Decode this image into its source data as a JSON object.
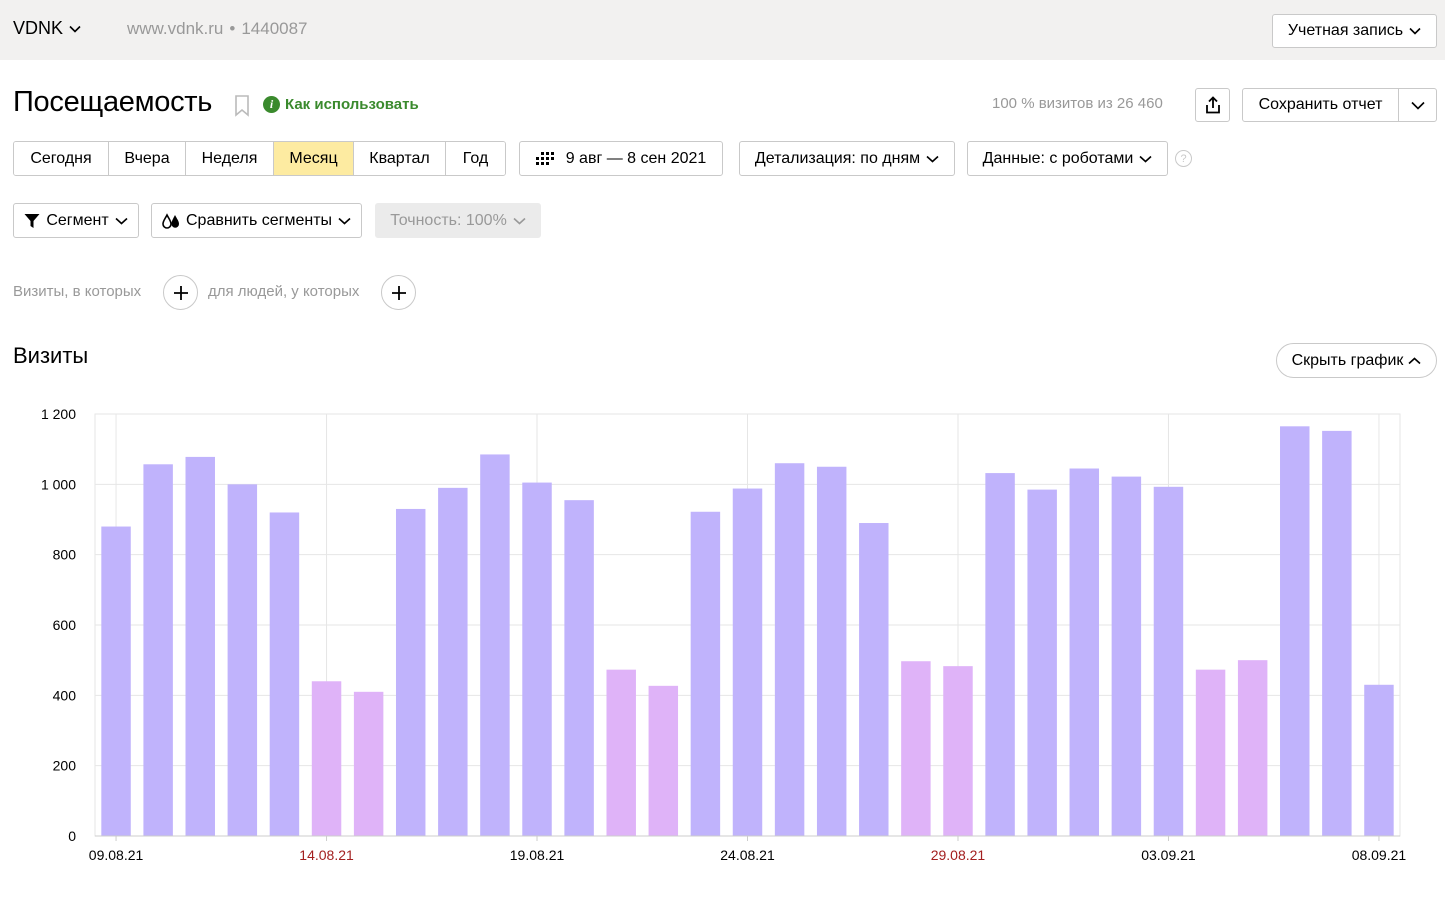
{
  "topbar": {
    "site_name": "VDNK",
    "site_url": "www.vdnk.ru",
    "separator": "•",
    "counter_id": "1440087",
    "account_label": "Учетная запись"
  },
  "header": {
    "title": "Посещаемость",
    "howto_label": "Как использовать",
    "visits_total": "100 % визитов из 26 460",
    "save_label": "Сохранить отчет"
  },
  "periods": [
    {
      "label": "Сегодня",
      "active": false
    },
    {
      "label": "Вчера",
      "active": false
    },
    {
      "label": "Неделя",
      "active": false
    },
    {
      "label": "Месяц",
      "active": true
    },
    {
      "label": "Квартал",
      "active": false
    },
    {
      "label": "Год",
      "active": false
    }
  ],
  "controls": {
    "date_range": "9 авг — 8 сен 2021",
    "detail": "Детализация: по дням",
    "data_mode": "Данные: с роботами",
    "help": "?",
    "segment": "Сегмент",
    "compare": "Сравнить сегменты",
    "accuracy": "Точность: 100%"
  },
  "filters": {
    "visits_label": "Визиты, в которых",
    "people_label": "для людей, у которых"
  },
  "chart_section": {
    "title": "Визиты",
    "hide_label": "Скрыть график"
  },
  "colors": {
    "weekday": "#c0b3fc",
    "weekend": "#dfb3f8",
    "weekend_label": "#a31f1f",
    "accent_yellow": "#fdeba1",
    "link_green": "#3a8a2d"
  },
  "chart_data": {
    "type": "bar",
    "title": "",
    "xlabel": "",
    "ylabel": "",
    "ylim": [
      0,
      1200
    ],
    "yticks": [
      "0",
      "200",
      "400",
      "600",
      "800",
      "1 000",
      "1 200"
    ],
    "ytick_values": [
      0,
      200,
      400,
      600,
      800,
      1000,
      1200
    ],
    "categories": [
      "09.08.21",
      "10.08.21",
      "11.08.21",
      "12.08.21",
      "13.08.21",
      "14.08.21",
      "15.08.21",
      "16.08.21",
      "17.08.21",
      "18.08.21",
      "19.08.21",
      "20.08.21",
      "21.08.21",
      "22.08.21",
      "23.08.21",
      "24.08.21",
      "25.08.21",
      "26.08.21",
      "27.08.21",
      "28.08.21",
      "29.08.21",
      "30.08.21",
      "31.08.21",
      "01.09.21",
      "02.09.21",
      "03.09.21",
      "04.09.21",
      "05.09.21",
      "06.09.21",
      "07.09.21",
      "08.09.21"
    ],
    "values": [
      880,
      1057,
      1078,
      1000,
      920,
      440,
      410,
      930,
      990,
      1085,
      1005,
      955,
      473,
      427,
      922,
      988,
      1060,
      1050,
      890,
      497,
      483,
      1032,
      985,
      1045,
      1022,
      993,
      473,
      500,
      1165,
      1152,
      430
    ],
    "weekend": [
      false,
      false,
      false,
      false,
      false,
      true,
      true,
      false,
      false,
      false,
      false,
      false,
      true,
      true,
      false,
      false,
      false,
      false,
      false,
      true,
      true,
      false,
      false,
      false,
      false,
      false,
      true,
      true,
      false,
      false,
      false
    ],
    "xtick_labels": [
      {
        "index": 0,
        "label": "09.08.21",
        "weekend": false
      },
      {
        "index": 5,
        "label": "14.08.21",
        "weekend": true
      },
      {
        "index": 10,
        "label": "19.08.21",
        "weekend": false
      },
      {
        "index": 15,
        "label": "24.08.21",
        "weekend": false
      },
      {
        "index": 20,
        "label": "29.08.21",
        "weekend": true
      },
      {
        "index": 25,
        "label": "03.09.21",
        "weekend": false
      },
      {
        "index": 30,
        "label": "08.09.21",
        "weekend": false
      }
    ],
    "grid": true,
    "legend": "none"
  }
}
